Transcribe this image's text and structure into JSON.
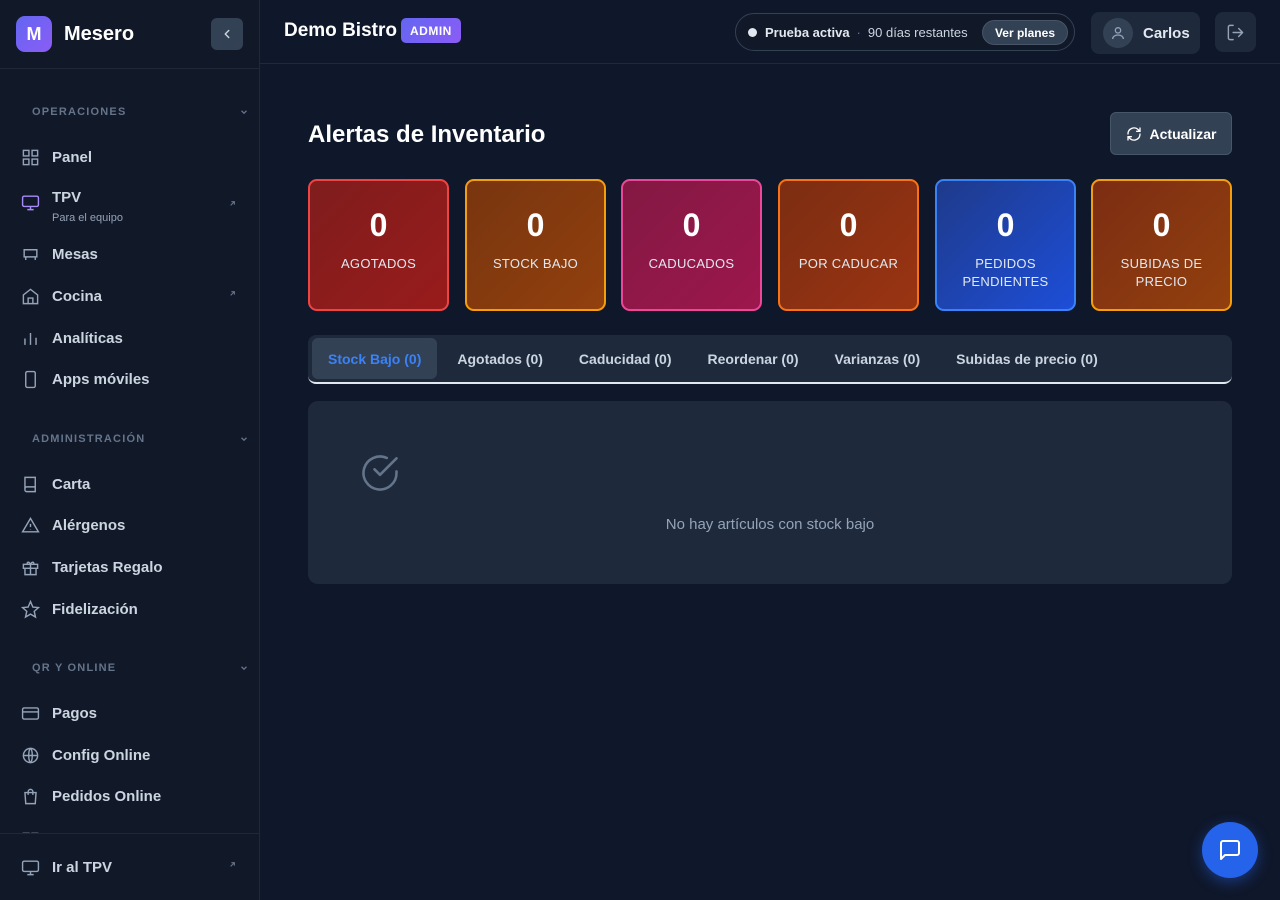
{
  "brand": {
    "logo_letter": "M",
    "name": "Mesero"
  },
  "sidebar": {
    "sections": [
      {
        "title": "OPERACIONES"
      },
      {
        "title": "ADMINISTRACIÓN"
      },
      {
        "title": "QR Y ONLINE"
      }
    ],
    "items": [
      {
        "label": "Panel",
        "icon": "grid-icon"
      },
      {
        "label": "TPV",
        "sublabel": "Para el equipo",
        "icon": "monitor-icon"
      },
      {
        "label": "Mesas",
        "icon": "table-icon"
      },
      {
        "label": "Cocina",
        "icon": "home-icon"
      },
      {
        "label": "Analíticas",
        "icon": "bar-chart-icon"
      },
      {
        "label": "Apps móviles",
        "icon": "smartphone-icon"
      },
      {
        "label": "Carta",
        "icon": "book-icon"
      },
      {
        "label": "Alérgenos",
        "icon": "warning-icon"
      },
      {
        "label": "Tarjetas Regalo",
        "icon": "gift-icon"
      },
      {
        "label": "Fidelización",
        "icon": "star-icon"
      },
      {
        "label": "Pagos",
        "icon": "credit-card-icon"
      },
      {
        "label": "Config Online",
        "icon": "globe-icon"
      },
      {
        "label": "Pedidos Online",
        "icon": "shopping-bag-icon"
      }
    ],
    "footer": {
      "label": "Ir al TPV",
      "icon": "monitor-icon"
    }
  },
  "header": {
    "restaurant": "Demo Bistro",
    "role_badge": "ADMIN",
    "trial_status": "Prueba activa",
    "trial_separator": "·",
    "trial_remaining": "90 días restantes",
    "plans_button": "Ver planes",
    "user_name": "Carlos"
  },
  "main": {
    "title": "Alertas de Inventario",
    "refresh_button": "Actualizar",
    "stats": [
      {
        "value": "0",
        "label": "AGOTADOS"
      },
      {
        "value": "0",
        "label": "STOCK BAJO"
      },
      {
        "value": "0",
        "label": "CADUCADOS"
      },
      {
        "value": "0",
        "label": "POR CADUCAR"
      },
      {
        "value": "0",
        "label": "PEDIDOS PENDIENTES"
      },
      {
        "value": "0",
        "label": "SUBIDAS DE PRECIO"
      }
    ],
    "tabs": [
      {
        "label": "Stock Bajo (0)",
        "active": true
      },
      {
        "label": "Agotados (0)"
      },
      {
        "label": "Caducidad (0)"
      },
      {
        "label": "Reordenar (0)"
      },
      {
        "label": "Varianzas (0)"
      },
      {
        "label": "Subidas de precio (0)"
      }
    ],
    "empty_message": "No hay artículos con stock bajo"
  },
  "colors": {
    "accent": "#6366f1",
    "active_tab_text": "#3b82f6",
    "chat_button": "#2563eb"
  }
}
